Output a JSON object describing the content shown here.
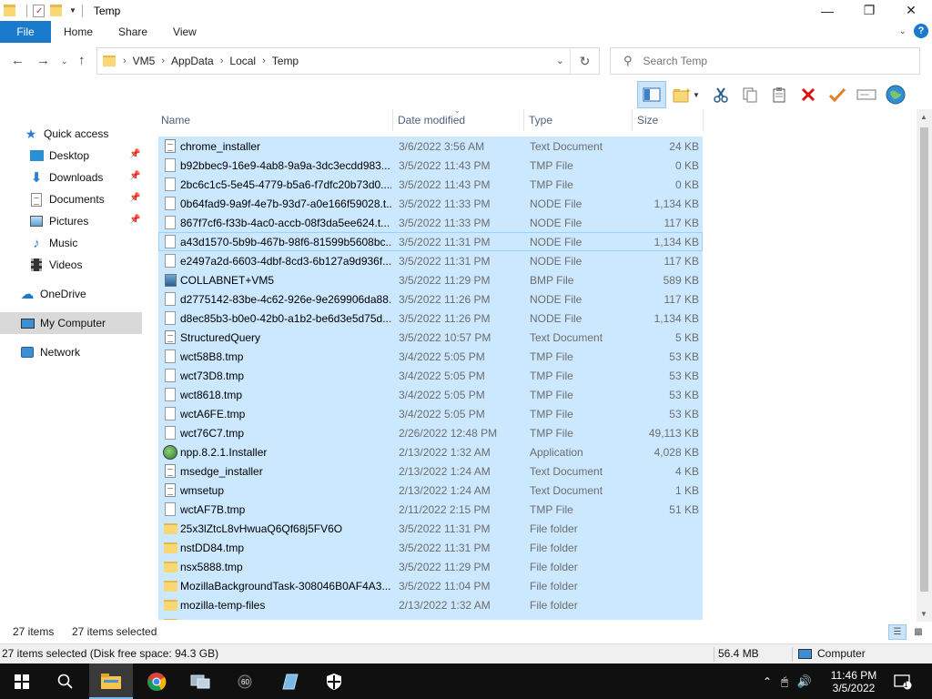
{
  "window": {
    "title": "Temp"
  },
  "ribbon": {
    "file": "File",
    "tabs": [
      "Home",
      "Share",
      "View"
    ],
    "help": "?"
  },
  "address": {
    "crumbs": [
      "VM5",
      "AppData",
      "Local",
      "Temp"
    ]
  },
  "search": {
    "placeholder": "Search Temp"
  },
  "navpane": {
    "quick_access": "Quick access",
    "items": [
      {
        "label": "Desktop",
        "pinned": true
      },
      {
        "label": "Downloads",
        "pinned": true
      },
      {
        "label": "Documents",
        "pinned": true
      },
      {
        "label": "Pictures",
        "pinned": true
      },
      {
        "label": "Music"
      },
      {
        "label": "Videos"
      }
    ],
    "onedrive": "OneDrive",
    "computer": "My Computer",
    "network": "Network"
  },
  "columns": {
    "name": "Name",
    "date": "Date modified",
    "type": "Type",
    "size": "Size"
  },
  "files": [
    {
      "name": "chrome_installer",
      "date": "3/6/2022 3:56 AM",
      "type": "Text Document",
      "size": "24 KB",
      "icon": "doc"
    },
    {
      "name": "b92bbec9-16e9-4ab8-9a9a-3dc3ecdd983...",
      "date": "3/5/2022 11:43 PM",
      "type": "TMP File",
      "size": "0 KB",
      "icon": "file"
    },
    {
      "name": "2bc6c1c5-5e45-4779-b5a6-f7dfc20b73d0....",
      "date": "3/5/2022 11:43 PM",
      "type": "TMP File",
      "size": "0 KB",
      "icon": "file"
    },
    {
      "name": "0b64fad9-9a9f-4e7b-93d7-a0e166f59028.t...",
      "date": "3/5/2022 11:33 PM",
      "type": "NODE File",
      "size": "1,134 KB",
      "icon": "file"
    },
    {
      "name": "867f7cf6-f33b-4ac0-accb-08f3da5ee624.t...",
      "date": "3/5/2022 11:33 PM",
      "type": "NODE File",
      "size": "117 KB",
      "icon": "file"
    },
    {
      "name": "a43d1570-5b9b-467b-98f6-81599b5608bc...",
      "date": "3/5/2022 11:31 PM",
      "type": "NODE File",
      "size": "1,134 KB",
      "icon": "file"
    },
    {
      "name": "e2497a2d-6603-4dbf-8cd3-6b127a9d936f...",
      "date": "3/5/2022 11:31 PM",
      "type": "NODE File",
      "size": "117 KB",
      "icon": "file"
    },
    {
      "name": "COLLABNET+VM5",
      "date": "3/5/2022 11:29 PM",
      "type": "BMP File",
      "size": "589 KB",
      "icon": "bmp"
    },
    {
      "name": "d2775142-83be-4c62-926e-9e269906da88...",
      "date": "3/5/2022 11:26 PM",
      "type": "NODE File",
      "size": "117 KB",
      "icon": "file"
    },
    {
      "name": "d8ec85b3-b0e0-42b0-a1b2-be6d3e5d75d...",
      "date": "3/5/2022 11:26 PM",
      "type": "NODE File",
      "size": "1,134 KB",
      "icon": "file"
    },
    {
      "name": "StructuredQuery",
      "date": "3/5/2022 10:57 PM",
      "type": "Text Document",
      "size": "5 KB",
      "icon": "doc"
    },
    {
      "name": "wct58B8.tmp",
      "date": "3/4/2022 5:05 PM",
      "type": "TMP File",
      "size": "53 KB",
      "icon": "file"
    },
    {
      "name": "wct73D8.tmp",
      "date": "3/4/2022 5:05 PM",
      "type": "TMP File",
      "size": "53 KB",
      "icon": "file"
    },
    {
      "name": "wct8618.tmp",
      "date": "3/4/2022 5:05 PM",
      "type": "TMP File",
      "size": "53 KB",
      "icon": "file"
    },
    {
      "name": "wctA6FE.tmp",
      "date": "3/4/2022 5:05 PM",
      "type": "TMP File",
      "size": "53 KB",
      "icon": "file"
    },
    {
      "name": "wct76C7.tmp",
      "date": "2/26/2022 12:48 PM",
      "type": "TMP File",
      "size": "49,113 KB",
      "icon": "file"
    },
    {
      "name": "npp.8.2.1.Installer",
      "date": "2/13/2022 1:32 AM",
      "type": "Application",
      "size": "4,028 KB",
      "icon": "app"
    },
    {
      "name": "msedge_installer",
      "date": "2/13/2022 1:24 AM",
      "type": "Text Document",
      "size": "4 KB",
      "icon": "doc"
    },
    {
      "name": "wmsetup",
      "date": "2/13/2022 1:24 AM",
      "type": "Text Document",
      "size": "1 KB",
      "icon": "doc"
    },
    {
      "name": "wctAF7B.tmp",
      "date": "2/11/2022 2:15 PM",
      "type": "TMP File",
      "size": "51 KB",
      "icon": "file"
    },
    {
      "name": "25x3lZtcL8vHwuaQ6Qf68j5FV6O",
      "date": "3/5/2022 11:31 PM",
      "type": "File folder",
      "size": "",
      "icon": "folder"
    },
    {
      "name": "nstDD84.tmp",
      "date": "3/5/2022 11:31 PM",
      "type": "File folder",
      "size": "",
      "icon": "folder"
    },
    {
      "name": "nsx5888.tmp",
      "date": "3/5/2022 11:29 PM",
      "type": "File folder",
      "size": "",
      "icon": "folder"
    },
    {
      "name": "MozillaBackgroundTask-308046B0AF4A3...",
      "date": "3/5/2022 11:04 PM",
      "type": "File folder",
      "size": "",
      "icon": "folder"
    },
    {
      "name": "mozilla-temp-files",
      "date": "2/13/2022 1:32 AM",
      "type": "File folder",
      "size": "",
      "icon": "folder"
    },
    {
      "name": "",
      "date": "",
      "type": "",
      "size": "",
      "icon": "folder"
    }
  ],
  "status": {
    "items": "27 items",
    "selected": "27 items selected",
    "detail": "27 items selected (Disk free space: 94.3 GB)",
    "size": "56.4 MB",
    "location": "Computer"
  },
  "taskbar": {
    "time": "11:46 PM",
    "date": "3/5/2022",
    "notif_count": "1"
  }
}
